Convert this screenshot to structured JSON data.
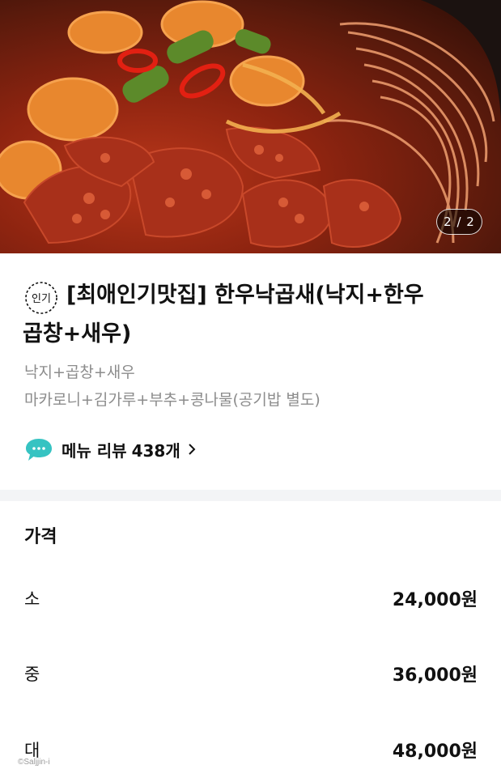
{
  "hero": {
    "image": "spicy-octopus-tripe-shrimp-stir-fry-photo",
    "counter": "2 / 2"
  },
  "menu": {
    "badge_icon": "popular-badge-icon",
    "badge_text": "인기",
    "title_line1": "[최애인기맛집] 한우낙곱새(낙지+한우",
    "title_line2": "곱창+새우)",
    "desc_line1": "낙지+곱창+새우",
    "desc_line2": "마카로니+김가루+부추+콩나물(공기밥 별도)"
  },
  "review": {
    "icon": "speech-bubble-icon",
    "label": "메뉴 리뷰",
    "count": "438개",
    "chevron": "chevron-right-icon"
  },
  "price": {
    "heading": "가격",
    "rows": [
      {
        "size": "소",
        "amount": "24,000원"
      },
      {
        "size": "중",
        "amount": "36,000원"
      },
      {
        "size": "대",
        "amount": "48,000원"
      }
    ]
  },
  "watermark": "©Saljjin-i",
  "colors": {
    "accent": "#36c3c2",
    "muted": "#8c8c8c",
    "divider": "#f3f4f6"
  }
}
